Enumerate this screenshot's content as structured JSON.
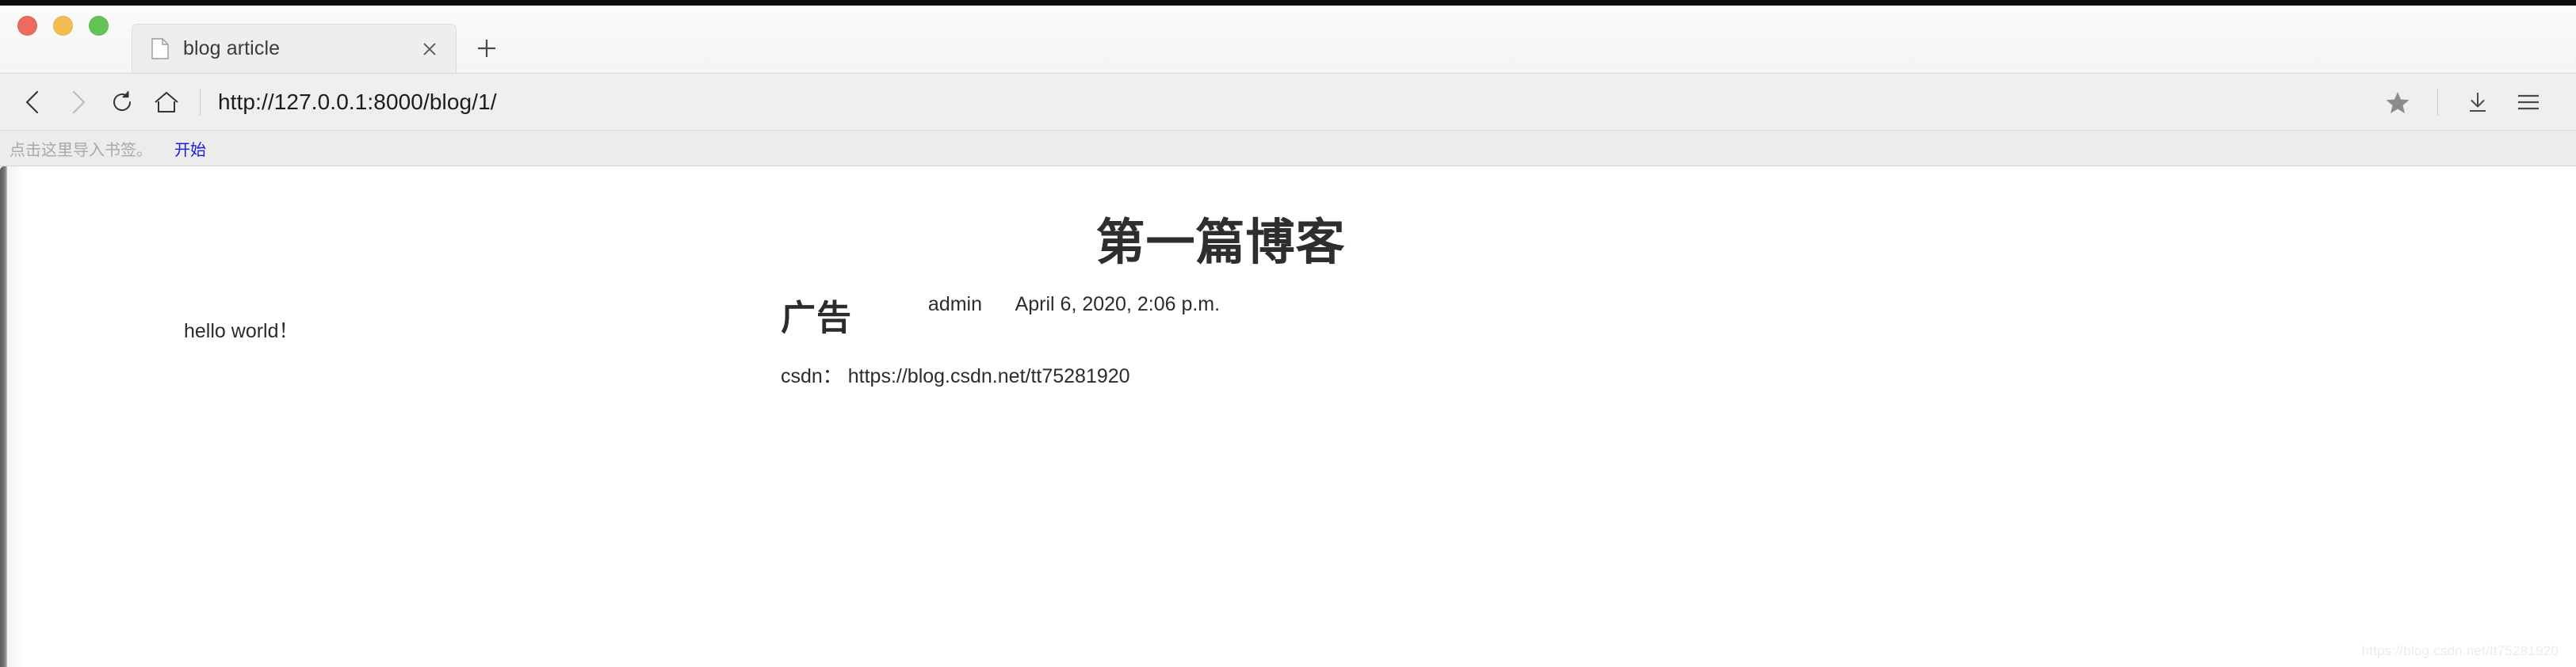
{
  "window": {
    "traffic_lights": [
      {
        "name": "close",
        "color": "#ec6a5e"
      },
      {
        "name": "minimize",
        "color": "#f4bd4f"
      },
      {
        "name": "zoom",
        "color": "#61c454"
      }
    ]
  },
  "tabs": {
    "active_index": 0,
    "items": [
      {
        "title": "blog article",
        "favicon": "document-icon",
        "close_glyph": "✕"
      }
    ],
    "new_tab_glyph": "+"
  },
  "toolbar": {
    "back_label": "‹",
    "forward_label": "›",
    "reload_label": "reload-icon",
    "home_label": "home-icon",
    "url": "http://127.0.0.1:8000/blog/1/",
    "bookmark_star": "★",
    "download_label": "download-icon",
    "menu_label": "menu-icon"
  },
  "bookmarks_bar": {
    "hint": "点击这里导入书签。",
    "link": "开始"
  },
  "page": {
    "title": "第一篇博客",
    "author": "admin",
    "published": "April 6, 2020, 2:06 p.m.",
    "body": "hello world！",
    "ad": {
      "heading": "广告",
      "link_text": "csdn： https://blog.csdn.net/tt75281920"
    },
    "watermark": "https://blog.csdn.net/tt75281920"
  },
  "colors": {
    "tab_bar_bg": "#f4f4f4",
    "toolbar_bg": "#efefef",
    "bookmarks_bg": "#ececec",
    "page_bg": "#ffffff",
    "link_blue": "#1a1ae6",
    "text_dark": "#2c2c2c"
  }
}
